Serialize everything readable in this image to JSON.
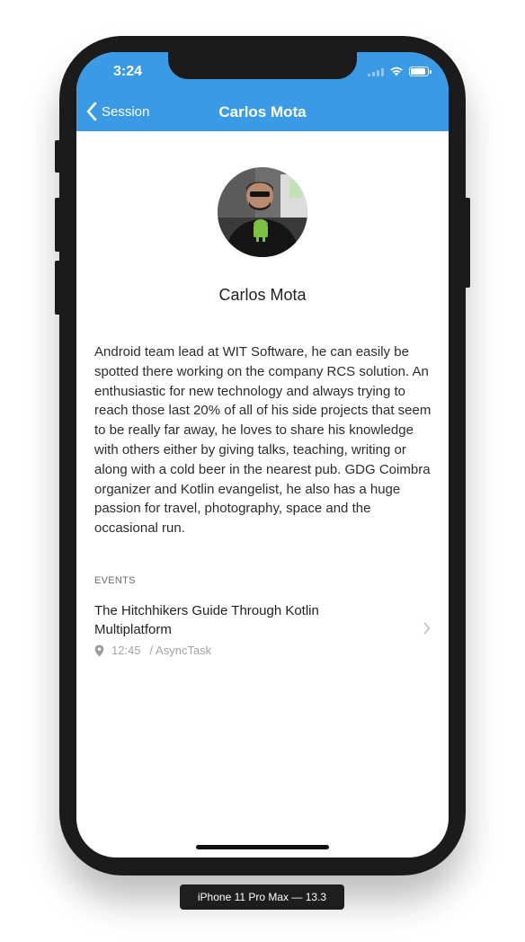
{
  "status_bar": {
    "time": "3:24",
    "battery_level": 0.9,
    "icons": [
      "signal-icon",
      "wifi-icon",
      "battery-icon"
    ]
  },
  "nav": {
    "back_label": "Session",
    "title": "Carlos Mota",
    "color": "#3a9ae6"
  },
  "speaker": {
    "name": "Carlos Mota",
    "bio": "Android team lead at WIT Software, he can easily be spotted there working on the company RCS solution. An enthusiastic for new technology and always trying to reach those last 20% of all of his side projects that seem to be really far away, he loves to share his knowledge with others either by giving talks, teaching, writing or along with a cold beer in the nearest pub. GDG Coimbra organizer and Kotlin evangelist, he also has a huge passion for travel, photography, space and the occasional run."
  },
  "events": {
    "header": "EVENTS",
    "items": [
      {
        "title": "The Hitchhikers Guide Through Kotlin Multiplatform",
        "time": "12:45",
        "room": "/ AsyncTask"
      }
    ]
  },
  "device_label": "iPhone 11 Pro Max — 13.3"
}
